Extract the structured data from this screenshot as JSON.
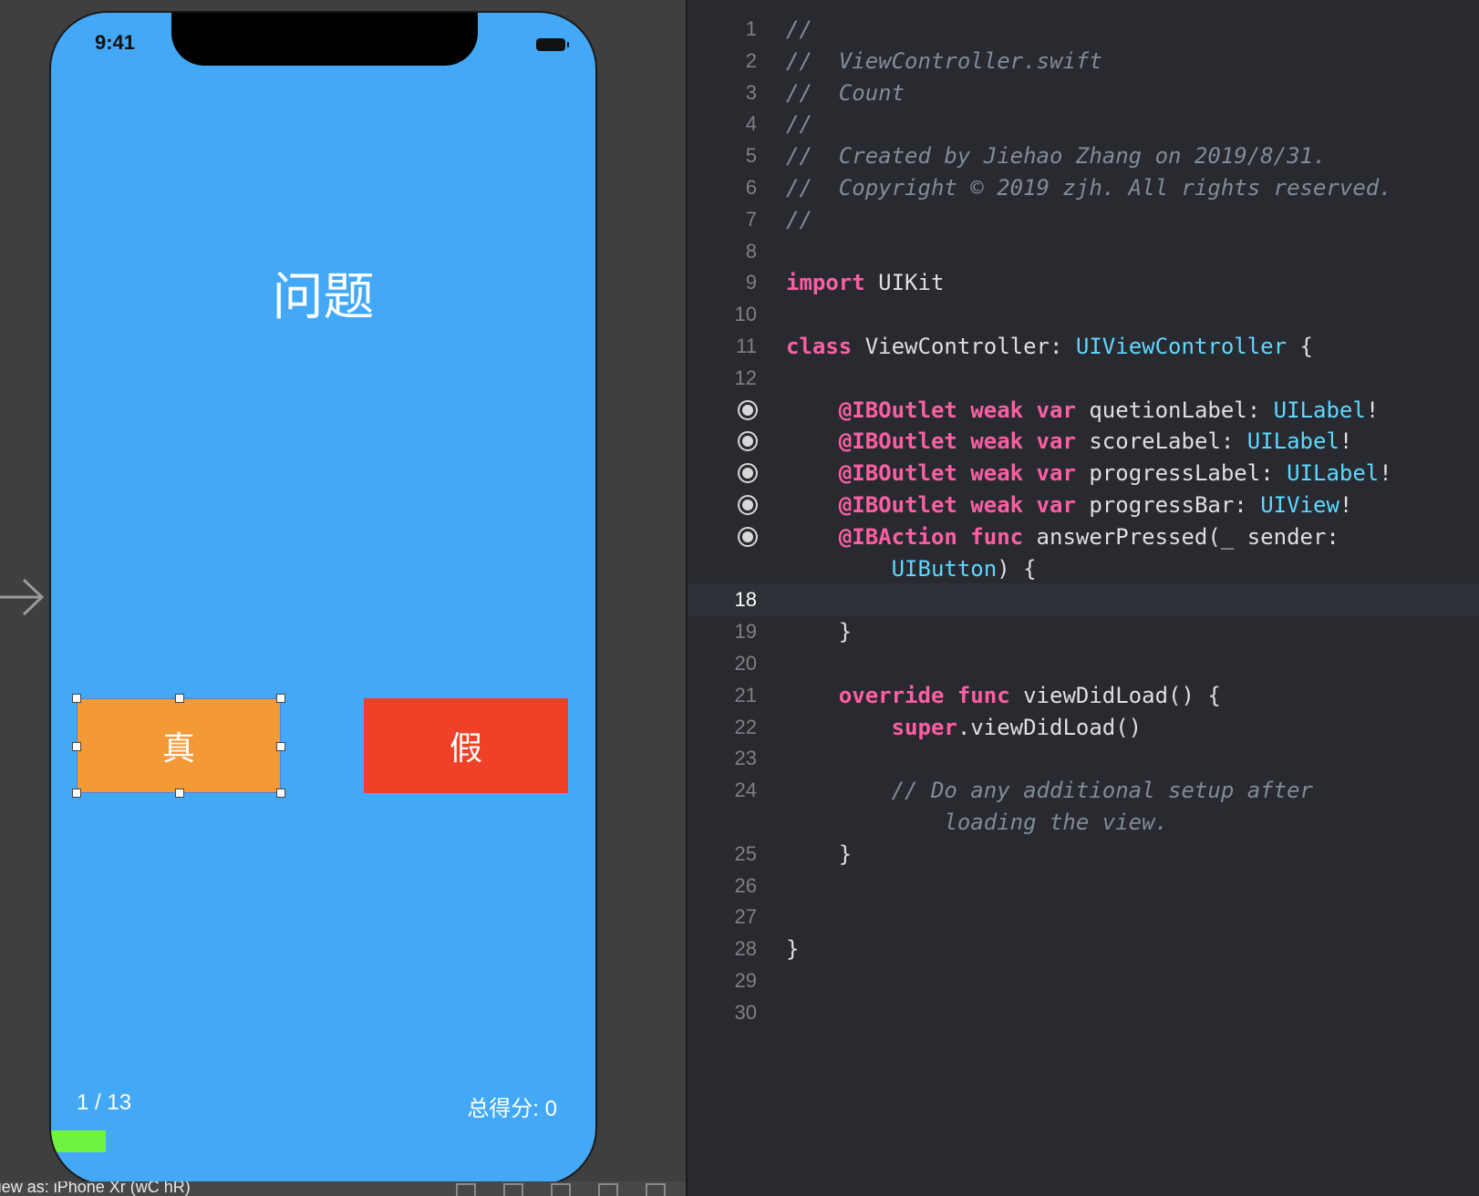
{
  "simulator": {
    "status_time": "9:41",
    "question_label": "问题",
    "true_button_label": "真",
    "false_button_label": "假",
    "progress_label": "1 / 13",
    "score_label": "总得分: 0",
    "progress_fraction": 0.1,
    "device_label": "View as: iPhone Xr (wC hR)",
    "colors": {
      "view_background": "#43a9f7",
      "true_button": "#f39a37",
      "false_button": "#ee4128",
      "progress_bar": "#70f33e"
    }
  },
  "editor": {
    "colors": {
      "background": "#292a30",
      "keyword": "#fc5fa3",
      "type": "#5dd8ff",
      "comment": "#7f8c98"
    },
    "lines": [
      {
        "num": "1",
        "text": "//",
        "style": "comment"
      },
      {
        "num": "2",
        "text": "//  ViewController.swift",
        "style": "comment"
      },
      {
        "num": "3",
        "text": "//  Count",
        "style": "comment"
      },
      {
        "num": "4",
        "text": "//",
        "style": "comment"
      },
      {
        "num": "5",
        "text": "//  Created by Jiehao Zhang on 2019/8/31.",
        "style": "comment"
      },
      {
        "num": "6",
        "text": "//  Copyright © 2019 zjh. All rights reserved.",
        "style": "comment"
      },
      {
        "num": "7",
        "text": "//",
        "style": "comment"
      },
      {
        "num": "8",
        "text": ""
      },
      {
        "num": "9",
        "text": "import UIKit"
      },
      {
        "num": "10",
        "text": ""
      },
      {
        "num": "11",
        "text": "class ViewController: UIViewController {"
      },
      {
        "num": "12",
        "text": ""
      },
      {
        "num": "",
        "outlet": true,
        "text": "    @IBOutlet weak var quetionLabel: UILabel!"
      },
      {
        "num": "",
        "outlet": true,
        "text": "    @IBOutlet weak var scoreLabel: UILabel!"
      },
      {
        "num": "",
        "outlet": true,
        "text": "    @IBOutlet weak var progressLabel: UILabel!"
      },
      {
        "num": "",
        "outlet": true,
        "text": "    @IBOutlet weak var progressBar: UIView!"
      },
      {
        "num": "",
        "outlet": true,
        "text": "    @IBAction func answerPressed(_ sender:"
      },
      {
        "num": "",
        "text": "        UIButton) {"
      },
      {
        "num": "18",
        "text": "",
        "current": true
      },
      {
        "num": "19",
        "text": "    }"
      },
      {
        "num": "20",
        "text": ""
      },
      {
        "num": "21",
        "text": "    override func viewDidLoad() {"
      },
      {
        "num": "22",
        "text": "        super.viewDidLoad()"
      },
      {
        "num": "23",
        "text": ""
      },
      {
        "num": "24",
        "text": "        // Do any additional setup after",
        "style": "comment"
      },
      {
        "num": "",
        "text": "            loading the view.",
        "style": "comment"
      },
      {
        "num": "25",
        "text": "    }"
      },
      {
        "num": "26",
        "text": ""
      },
      {
        "num": "27",
        "text": ""
      },
      {
        "num": "28",
        "text": "}"
      },
      {
        "num": "29",
        "text": ""
      },
      {
        "num": "30",
        "text": ""
      }
    ]
  }
}
